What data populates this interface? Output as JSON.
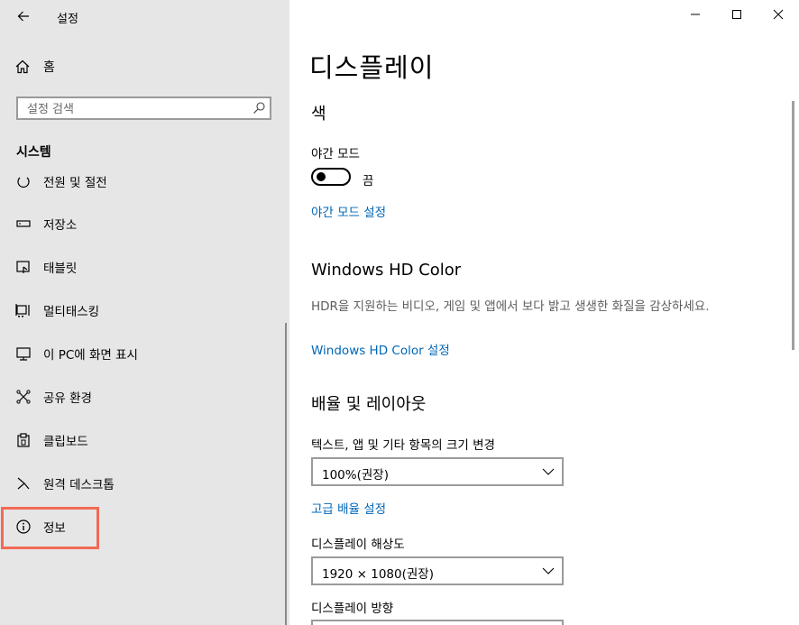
{
  "window": {
    "title": "설정",
    "controls": [
      "minimize",
      "maximize",
      "close"
    ]
  },
  "sidebar": {
    "home_label": "홈",
    "search_placeholder": "설정 검색",
    "section_title": "시스템",
    "items": [
      {
        "label": "전원 및 절전",
        "icon": "power-icon"
      },
      {
        "label": "저장소",
        "icon": "storage-icon"
      },
      {
        "label": "태블릿",
        "icon": "tablet-icon"
      },
      {
        "label": "멀티태스킹",
        "icon": "multitasking-icon"
      },
      {
        "label": "이 PC에 화면 표시",
        "icon": "project-icon"
      },
      {
        "label": "공유 환경",
        "icon": "shared-experiences-icon"
      },
      {
        "label": "클립보드",
        "icon": "clipboard-icon"
      },
      {
        "label": "원격 데스크톱",
        "icon": "remote-desktop-icon"
      },
      {
        "label": "정보",
        "icon": "info-icon",
        "highlighted": true
      }
    ]
  },
  "main": {
    "page_title": "디스플레이",
    "color_section": {
      "title": "색",
      "night_mode_label": "야간 모드",
      "toggle_state": "끔",
      "night_mode_link": "야간 모드 설정"
    },
    "hdr_section": {
      "title": "Windows HD Color",
      "description": "HDR을 지원하는 비디오, 게임 및 앱에서 보다 밝고 생생한 화질을 감상하세요.",
      "link": "Windows HD Color 설정"
    },
    "scale_section": {
      "title": "배율 및 레이아웃",
      "text_size_label": "텍스트, 앱 및 기타 항목의 크기 변경",
      "text_size_value": "100%(권장)",
      "advanced_link": "고급 배율 설정",
      "resolution_label": "디스플레이 해상도",
      "resolution_value": "1920 × 1080(권장)",
      "orientation_label": "디스플레이 방향"
    }
  },
  "colors": {
    "sidebar_bg": "#e6e6e6",
    "link": "#0067b8",
    "highlight_border": "#f26a55"
  }
}
